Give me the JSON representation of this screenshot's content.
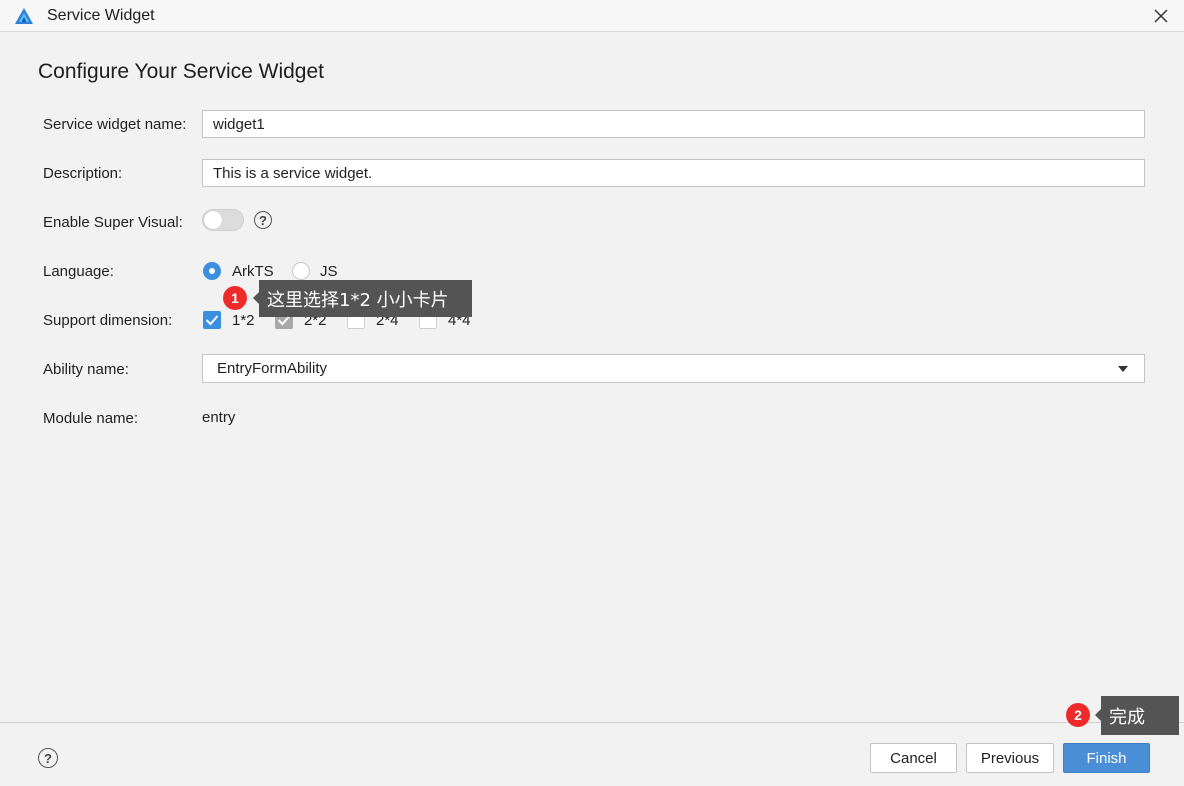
{
  "window": {
    "title": "Service Widget",
    "logo_icon": "harmony-deveco-logo",
    "close_icon": "close-icon"
  },
  "page": {
    "title": "Configure Your Service Widget"
  },
  "form": {
    "widget_name": {
      "label": "Service widget name:",
      "value": "widget1"
    },
    "description": {
      "label": "Description:",
      "value": "This is a service widget."
    },
    "super_visual": {
      "label": "Enable Super Visual:",
      "enabled": false,
      "help_icon": "question-circle-icon"
    },
    "language": {
      "label": "Language:",
      "options": [
        {
          "label": "ArkTS",
          "selected": true
        },
        {
          "label": "JS",
          "selected": false
        }
      ]
    },
    "support_dimension": {
      "label": "Support dimension:",
      "options": [
        {
          "label": "1*2",
          "state": "checked"
        },
        {
          "label": "2*2",
          "state": "checked-disabled"
        },
        {
          "label": "2*4",
          "state": "unchecked"
        },
        {
          "label": "4*4",
          "state": "unchecked"
        }
      ]
    },
    "ability_name": {
      "label": "Ability name:",
      "value": "EntryFormAbility"
    },
    "module_name": {
      "label": "Module name:",
      "value": "entry"
    }
  },
  "footer": {
    "help_icon": "question-circle-icon",
    "cancel_label": "Cancel",
    "previous_label": "Previous",
    "finish_label": "Finish"
  },
  "annotations": [
    {
      "number": "1",
      "text": "这里选择1*2 小小卡片"
    },
    {
      "number": "2",
      "text": "完成"
    }
  ],
  "colors": {
    "accent": "#3c8ee0",
    "primary_button": "#4a8fd6",
    "callout_bg": "#545454",
    "badge_red": "#ee2a2a"
  }
}
